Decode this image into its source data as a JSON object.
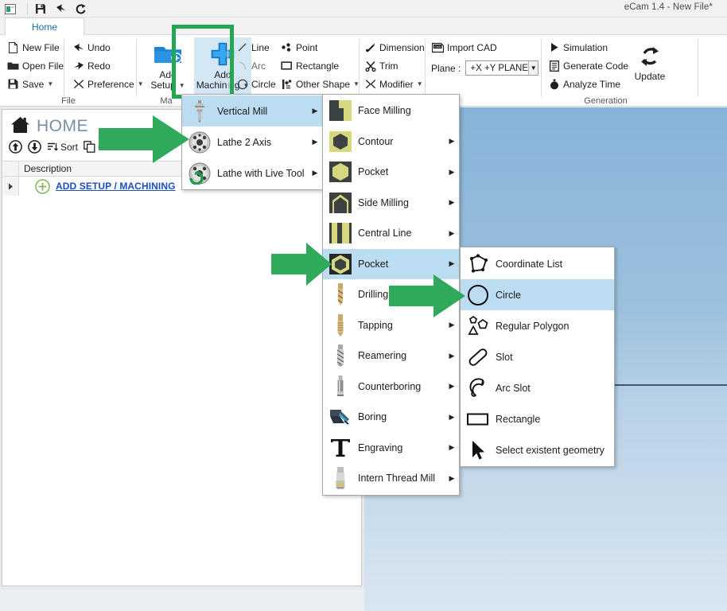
{
  "window": {
    "title": "eCam 1.4 - New File*",
    "quick_access": [
      "restore-icon",
      "save-icon",
      "undo-icon",
      "redo-icon"
    ]
  },
  "ribbon": {
    "active_tab": "Home",
    "groups": [
      {
        "name": "File",
        "label": "File",
        "columns": [
          [
            {
              "label": "New File",
              "icon": "new-file-icon",
              "caret": false
            },
            {
              "label": "Open File",
              "icon": "open-file-icon",
              "caret": false
            },
            {
              "label": "Save",
              "icon": "save-icon",
              "caret": true
            }
          ],
          [
            {
              "label": "Undo",
              "icon": "undo-icon",
              "caret": false
            },
            {
              "label": "Redo",
              "icon": "redo-icon",
              "caret": false
            },
            {
              "label": "Preference",
              "icon": "preference-icon",
              "caret": true
            }
          ]
        ]
      },
      {
        "name": "Machining",
        "label": "Ma",
        "big_buttons": [
          {
            "label": "Add\nSetup",
            "line1": "Add",
            "line2": "Setup",
            "icon": "add-setup-icon",
            "caret": true,
            "highlighted": false
          },
          {
            "label": "Add\nMachining",
            "line1": "Add",
            "line2": "Machining",
            "icon": "add-machining-icon",
            "caret": true,
            "highlighted": true
          }
        ]
      },
      {
        "name": "Geometry",
        "label": "",
        "columns": [
          [
            {
              "label": "Line",
              "icon": "line-icon",
              "caret": false
            },
            {
              "label": "Arc",
              "icon": "arc-icon",
              "caret": false
            },
            {
              "label": "Circle",
              "icon": "circle-icon",
              "caret": false
            }
          ],
          [
            {
              "label": "Point",
              "icon": "point-icon",
              "caret": false
            },
            {
              "label": "Rectangle",
              "icon": "rectangle-icon",
              "caret": false
            },
            {
              "label": "Other Shape",
              "icon": "other-shape-icon",
              "caret": true
            }
          ]
        ]
      },
      {
        "name": "Modify",
        "label": "",
        "columns": [
          [
            {
              "label": "Dimension",
              "icon": "dimension-icon",
              "caret": false
            },
            {
              "label": "Trim",
              "icon": "trim-icon",
              "caret": false
            },
            {
              "label": "Modifier",
              "icon": "modifier-icon",
              "caret": true
            }
          ]
        ]
      },
      {
        "name": "CAD",
        "label": "",
        "import_cad": {
          "label": "Import CAD",
          "icon": "import-cad-icon"
        },
        "plane": {
          "label": "Plane :",
          "value": "+X +Y PLANE"
        }
      },
      {
        "name": "Generation",
        "label": "Generation",
        "columns": [
          [
            {
              "label": "Simulation",
              "icon": "play-icon",
              "caret": false
            },
            {
              "label": "Generate Code",
              "icon": "code-icon",
              "caret": false
            },
            {
              "label": "Analyze Time",
              "icon": "clock-icon",
              "caret": false
            }
          ]
        ],
        "update": {
          "label": "Update",
          "icon": "refresh-icon"
        }
      }
    ]
  },
  "left_panel": {
    "title": "HOME",
    "title_icon": "home-icon",
    "toolbar": [
      {
        "label": "",
        "icon": "move-up-icon"
      },
      {
        "label": "",
        "icon": "move-down-icon"
      },
      {
        "label": "Sort",
        "icon": "sort-icon"
      },
      {
        "label": "Clone",
        "icon": "clone-icon"
      }
    ],
    "column_header": "Description",
    "rows": [
      {
        "label": "ADD SETUP / MACHINING",
        "icon": "plus-circle-icon",
        "expander": "expand-arrow-icon"
      }
    ]
  },
  "menus": {
    "machine_type": {
      "items": [
        {
          "label": "Vertical Mill",
          "icon": "vertical-mill-icon",
          "submenu": true,
          "selected": true
        },
        {
          "label": "Lathe 2 Axis",
          "icon": "lathe-chuck-icon",
          "submenu": true,
          "selected": false
        },
        {
          "label": "Lathe with Live Tool",
          "icon": "lathe-live-tool-icon",
          "submenu": true,
          "selected": false
        }
      ]
    },
    "vertical_mill": {
      "items": [
        {
          "label": "Face Milling",
          "icon": "face-milling-icon",
          "submenu": false,
          "selected": false
        },
        {
          "label": "Contour",
          "icon": "contour-icon",
          "submenu": true,
          "selected": false
        },
        {
          "label": "Pocket",
          "icon": "pocket-icon",
          "submenu": true,
          "selected": false
        },
        {
          "label": "Side Milling",
          "icon": "side-milling-icon",
          "submenu": true,
          "selected": false
        },
        {
          "label": "Central Line",
          "icon": "central-line-icon",
          "submenu": true,
          "selected": false
        },
        {
          "label": "Pocket",
          "icon": "pocket2-icon",
          "submenu": true,
          "selected": true
        },
        {
          "label": "Drilling",
          "icon": "drilling-icon",
          "submenu": true,
          "selected": false
        },
        {
          "label": "Tapping",
          "icon": "tapping-icon",
          "submenu": true,
          "selected": false
        },
        {
          "label": "Reamering",
          "icon": "reamering-icon",
          "submenu": true,
          "selected": false
        },
        {
          "label": "Counterboring",
          "icon": "counterboring-icon",
          "submenu": true,
          "selected": false
        },
        {
          "label": "Boring",
          "icon": "boring-icon",
          "submenu": true,
          "selected": false
        },
        {
          "label": "Engraving",
          "icon": "engraving-icon",
          "submenu": true,
          "selected": false
        },
        {
          "label": "Intern Thread Mill",
          "icon": "intern-thread-mill-icon",
          "submenu": true,
          "selected": false
        }
      ]
    },
    "pocket_shapes": {
      "items": [
        {
          "label": "Coordinate List",
          "icon": "coordinate-list-icon",
          "submenu": false,
          "selected": false
        },
        {
          "label": "Circle",
          "icon": "circle-shape-icon",
          "submenu": false,
          "selected": true
        },
        {
          "label": "Regular Polygon",
          "icon": "regular-polygon-icon",
          "submenu": false,
          "selected": false
        },
        {
          "label": "Slot",
          "icon": "slot-icon",
          "submenu": false,
          "selected": false
        },
        {
          "label": "Arc Slot",
          "icon": "arc-slot-icon",
          "submenu": false,
          "selected": false
        },
        {
          "label": "Rectangle",
          "icon": "rectangle-shape-icon",
          "submenu": false,
          "selected": false
        },
        {
          "label": "Select existent geometry",
          "icon": "cursor-arrow-icon",
          "submenu": false,
          "selected": false
        }
      ]
    }
  },
  "annotations": {
    "arrow_color": "#2eaa5a",
    "highlight_color": "#26a552",
    "arrows": [
      {
        "name": "arrow-to-add-machining-menu"
      },
      {
        "name": "arrow-to-pocket-item"
      },
      {
        "name": "arrow-to-circle-item"
      }
    ]
  },
  "colors": {
    "accent": "#1a6ba8",
    "selection": "#bcdcf2",
    "link": "#1c4fbe",
    "viewport_top": "#86b3d8",
    "viewport_bottom": "#d9e6f0",
    "tool_yellow": "#d7d77e"
  }
}
